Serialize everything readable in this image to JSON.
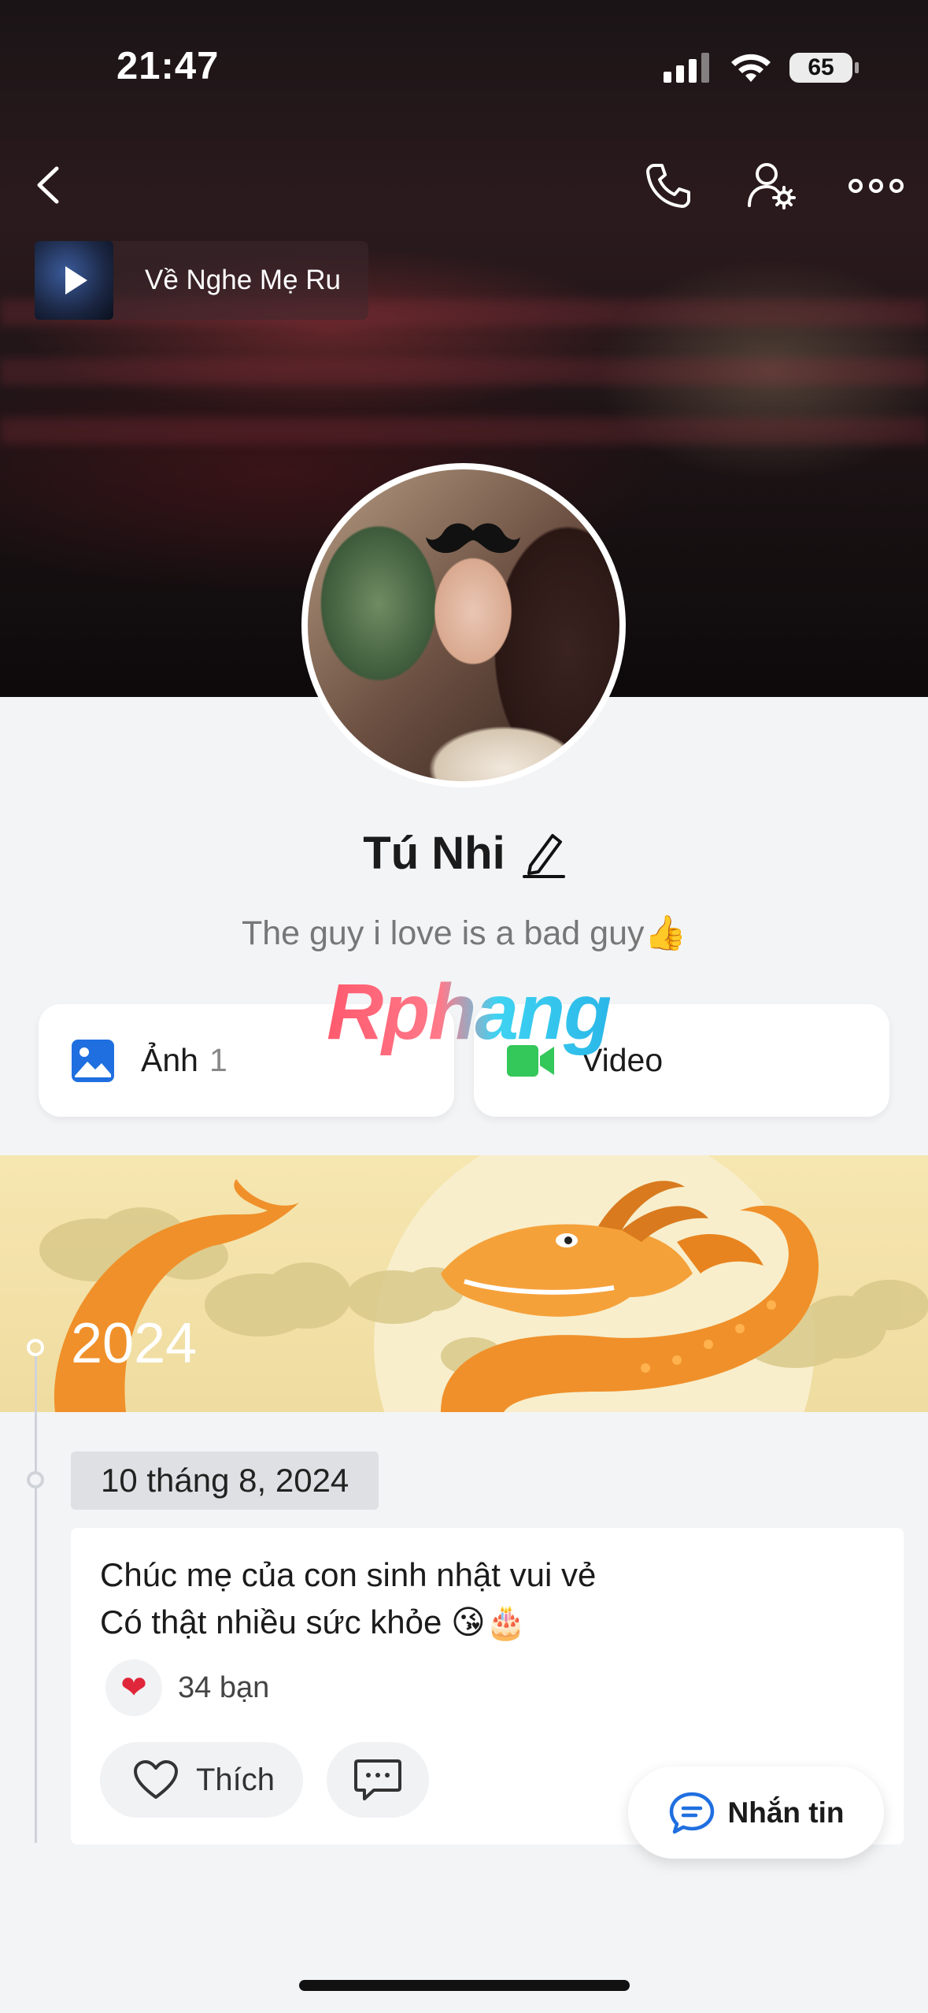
{
  "status_bar": {
    "time": "21:47",
    "battery": "65"
  },
  "music": {
    "title": "Về Nghe Mẹ Ru"
  },
  "profile": {
    "name": "Tú Nhi",
    "bio": "The guy i love is a bad guy👍"
  },
  "watermark": "Rphang",
  "media": {
    "photos_label": "Ảnh",
    "photos_count": "1",
    "videos_label": "Video"
  },
  "timeline": {
    "year": "2024",
    "date": "10 tháng 8, 2024"
  },
  "post": {
    "line1": "Chúc mẹ của con sinh nhật vui vẻ",
    "line2": "Có thật nhiều sức khỏe 😘🎂",
    "reaction_count": "34 bạn",
    "like_label": "Thích"
  },
  "fab": {
    "message_label": "Nhắn tin"
  },
  "colors": {
    "accent_blue": "#1f6fe0",
    "video_green": "#34c759",
    "heart_red": "#e0263a",
    "banner_yellow": "#f6e6b0",
    "dragon_orange": "#f0902a"
  }
}
